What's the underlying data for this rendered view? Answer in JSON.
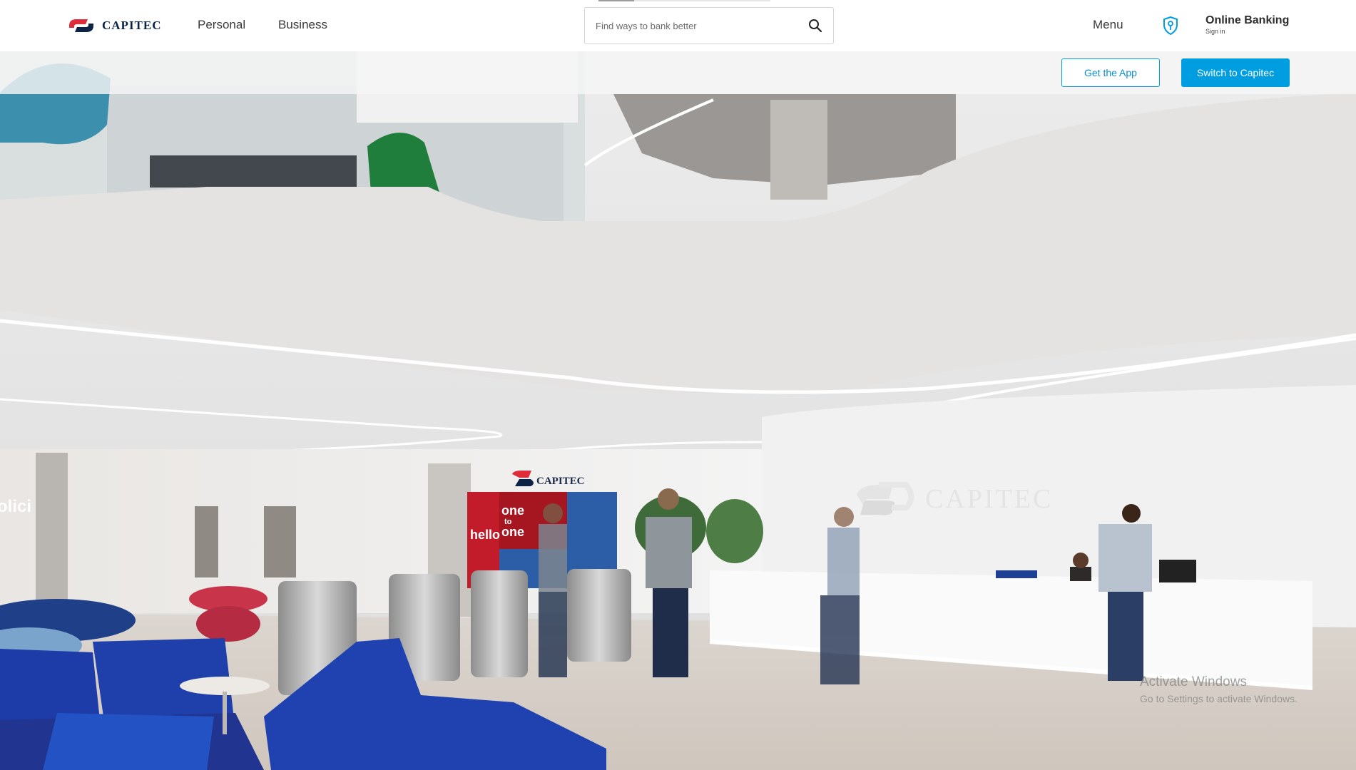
{
  "brand": {
    "name": "CAPITEC",
    "colors": {
      "navy": "#0b2345",
      "red": "#e02b3a",
      "blue": "#009de0"
    }
  },
  "nav": {
    "logo_icon": "capitec-logo-icon",
    "links": [
      {
        "label": "Personal"
      },
      {
        "label": "Business"
      }
    ]
  },
  "search": {
    "placeholder": "Find ways to bank better",
    "value": "",
    "icon": "search-icon"
  },
  "header_right": {
    "menu_label": "Menu",
    "shield_icon": "shield-icon",
    "online_banking": {
      "title": "Online Banking",
      "subtitle": "Sign in"
    }
  },
  "actions": {
    "get_app_label": "Get the App",
    "switch_label": "Switch to Capitec"
  },
  "hero": {
    "description_icon": "office-lobby-photo",
    "signage": {
      "wall_logo_text": "CAPITEC",
      "branch_sign_text": "CAPITEC",
      "wall_fragment_text": "olici",
      "screen_words": [
        "one",
        "to",
        "one"
      ],
      "hello_text": "hello"
    }
  },
  "os_watermark": {
    "title": "Activate Windows",
    "subtitle": "Go to Settings to activate Windows."
  }
}
